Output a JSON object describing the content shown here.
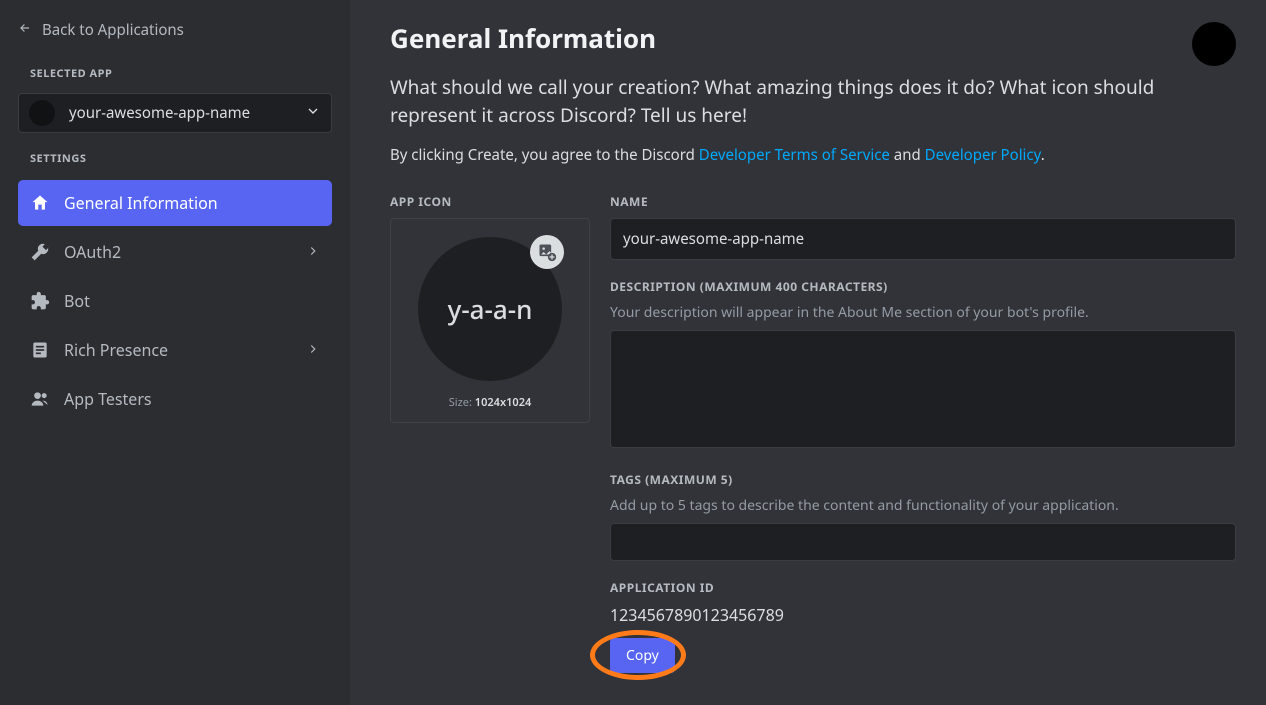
{
  "sidebar": {
    "back_label": "Back to Applications",
    "selected_app_label": "SELECTED APP",
    "app_name": "your-awesome-app-name",
    "settings_label": "SETTINGS",
    "items": [
      {
        "label": "General Information"
      },
      {
        "label": "OAuth2"
      },
      {
        "label": "Bot"
      },
      {
        "label": "Rich Presence"
      },
      {
        "label": "App Testers"
      }
    ]
  },
  "main": {
    "title": "General Information",
    "lead": "What should we call your creation? What amazing things does it do? What icon should represent it across Discord? Tell us here!",
    "tos_prefix": "By clicking Create, you agree to the Discord ",
    "tos_link1": "Developer Terms of Service",
    "tos_and": " and ",
    "tos_link2": "Developer Policy",
    "tos_period": ".",
    "app_icon_label": "APP ICON",
    "icon_initials": "y-a-a-n",
    "size_prefix": "Size: ",
    "size_value": "1024x1024",
    "name_label": "NAME",
    "name_value": "your-awesome-app-name",
    "desc_label": "DESCRIPTION (MAXIMUM 400 CHARACTERS)",
    "desc_helper": "Your description will appear in the About Me section of your bot's profile.",
    "desc_value": "",
    "tags_label": "TAGS (MAXIMUM 5)",
    "tags_helper": "Add up to 5 tags to describe the content and functionality of your application.",
    "tags_value": "",
    "appid_label": "APPLICATION ID",
    "appid_value": "1234567890123456789",
    "copy_label": "Copy"
  }
}
